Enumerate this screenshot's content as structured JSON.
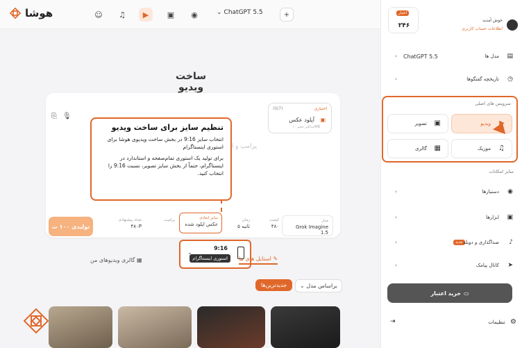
{
  "app": {
    "logo_text": "هوشا"
  },
  "topbar": {
    "model_label": "ChatGPT 5.5"
  },
  "main": {
    "title": "ساخت ویدیو",
    "upload": {
      "optional": "اختیاری",
      "counter": "(0/7)",
      "label": "آپلود عکس",
      "sub": "حداکثر حجم ۱۰MB"
    },
    "prompt_placeholder": "پرامپ و ایده های خودتون رو اینجا بنویسید",
    "tooltip": {
      "title": "تنظیم سایز برای ساخت ویدیو",
      "p1": "انتخاب سایز 9:16 در بخش ساخت ویدیوی هوشا برای استوری اینستاگرام",
      "p2": "برای تولید یک استوری تمام‌صفحه و استاندارد در اینستاگرام، حتماً از بخش سایز تصویر، نسبت 9:16 را انتخاب کنید."
    },
    "options": {
      "model": {
        "label": "مدل",
        "value": "Grok Imagine 1.5"
      },
      "quality": {
        "label": "کیفیت",
        "value": "۴۸۰"
      },
      "duration": {
        "label": "زمان",
        "value": "۵ ثانیه"
      },
      "size": {
        "label": "سایز ابعادی",
        "value": "عکس اپلود شده"
      },
      "aux": {
        "label": "پرامپت",
        "value": "پرامپت"
      },
      "aux2": {
        "label": "تعداد پیشنهادی",
        "value": "۴۸۰P"
      },
      "generate": "تولیدی ۱۰۰ ت"
    },
    "size_dropdown": {
      "ratio": "9:16",
      "label": "استوری اینستاگرام"
    },
    "tabs": {
      "styles": "استایل های ما",
      "gallery": "گالری ویدیوهای من"
    },
    "sort_label": "براساس مدل",
    "new_label": "جدیدترین‌ها"
  },
  "sidebar": {
    "credit": {
      "badge": "اعتبار",
      "value": "۲۴۶"
    },
    "welcome": "خوش آمدید",
    "welcome_sub": "اطلاعات حساب کاربری",
    "models": {
      "label": "مدل ها",
      "value": "ChatGPT 5.5"
    },
    "history": {
      "label": "تاریخچه گفتگوها"
    },
    "main_services_title": "سرویس های اصلی",
    "services": [
      {
        "label": "ویدیو",
        "icon": "video-icon",
        "active": true
      },
      {
        "label": "تصویر",
        "icon": "image-icon",
        "active": false
      },
      {
        "label": "موزیک",
        "icon": "music-icon",
        "active": false
      },
      {
        "label": "گالری",
        "icon": "gallery-icon",
        "active": false
      }
    ],
    "more_title": "سایر امکانات",
    "more": [
      {
        "label": "دستیارها",
        "icon": "assistant-icon"
      },
      {
        "label": "ابزارها",
        "icon": "tools-icon"
      },
      {
        "label": "صداگذاری و دوبله",
        "icon": "mic-icon",
        "badge": "جدید"
      },
      {
        "label": "کانال پیامک",
        "icon": "send-icon"
      }
    ],
    "buy_label": "خرید اعتبار",
    "settings_label": "تنظیمات"
  },
  "colors": {
    "accent": "#e0672a",
    "accent_light": "#fde7d9"
  }
}
